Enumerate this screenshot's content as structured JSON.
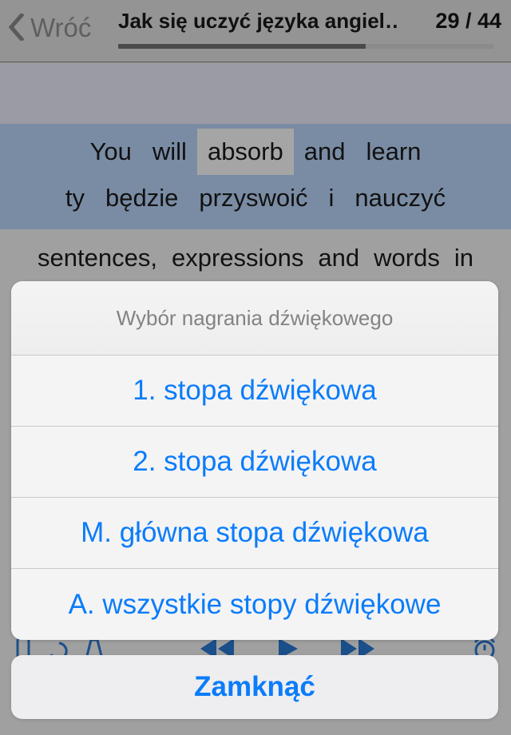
{
  "nav": {
    "back_label": "Wróć",
    "back_icon": "chevron-left-icon",
    "doc_title": "Jak się uczyć języka angiel…",
    "page_counter": "29 / 44",
    "progress_percent": 66
  },
  "content": {
    "highlighted_block": {
      "english_words": [
        "You",
        "will",
        "absorb",
        "and",
        "learn"
      ],
      "highlighted_word": "absorb",
      "polish_words": [
        "ty",
        "będzie",
        "przyswoić",
        "i",
        "nauczyć"
      ]
    },
    "next_line_words": [
      "sentences,",
      "expressions",
      "and",
      "words",
      "in"
    ]
  },
  "media_toolbar": {
    "icons": [
      "loop-icon",
      "repeat-icon",
      "metronome-icon",
      "rewind-icon",
      "previous-icon",
      "play-icon",
      "next-icon",
      "fast-forward-icon",
      "timer-icon"
    ]
  },
  "action_sheet": {
    "title": "Wybór nagrania dźwiękowego",
    "options": [
      {
        "label": "1. stopa dźwiękowa"
      },
      {
        "label": "2. stopa dźwiękowa"
      },
      {
        "label": "M. główna stopa dźwiękowa"
      },
      {
        "label": "A. wszystkie stopy dźwiękowe"
      }
    ],
    "cancel_label": "Zamknąć"
  },
  "colors": {
    "accent_blue": "#0b7cfa",
    "toolbar_blue": "#1b4f8a",
    "sentence_block": "#7a8ca4",
    "highlight_gray": "#a5a5a5",
    "page_background": "#a0a0a0",
    "nav_background": "#949494"
  }
}
